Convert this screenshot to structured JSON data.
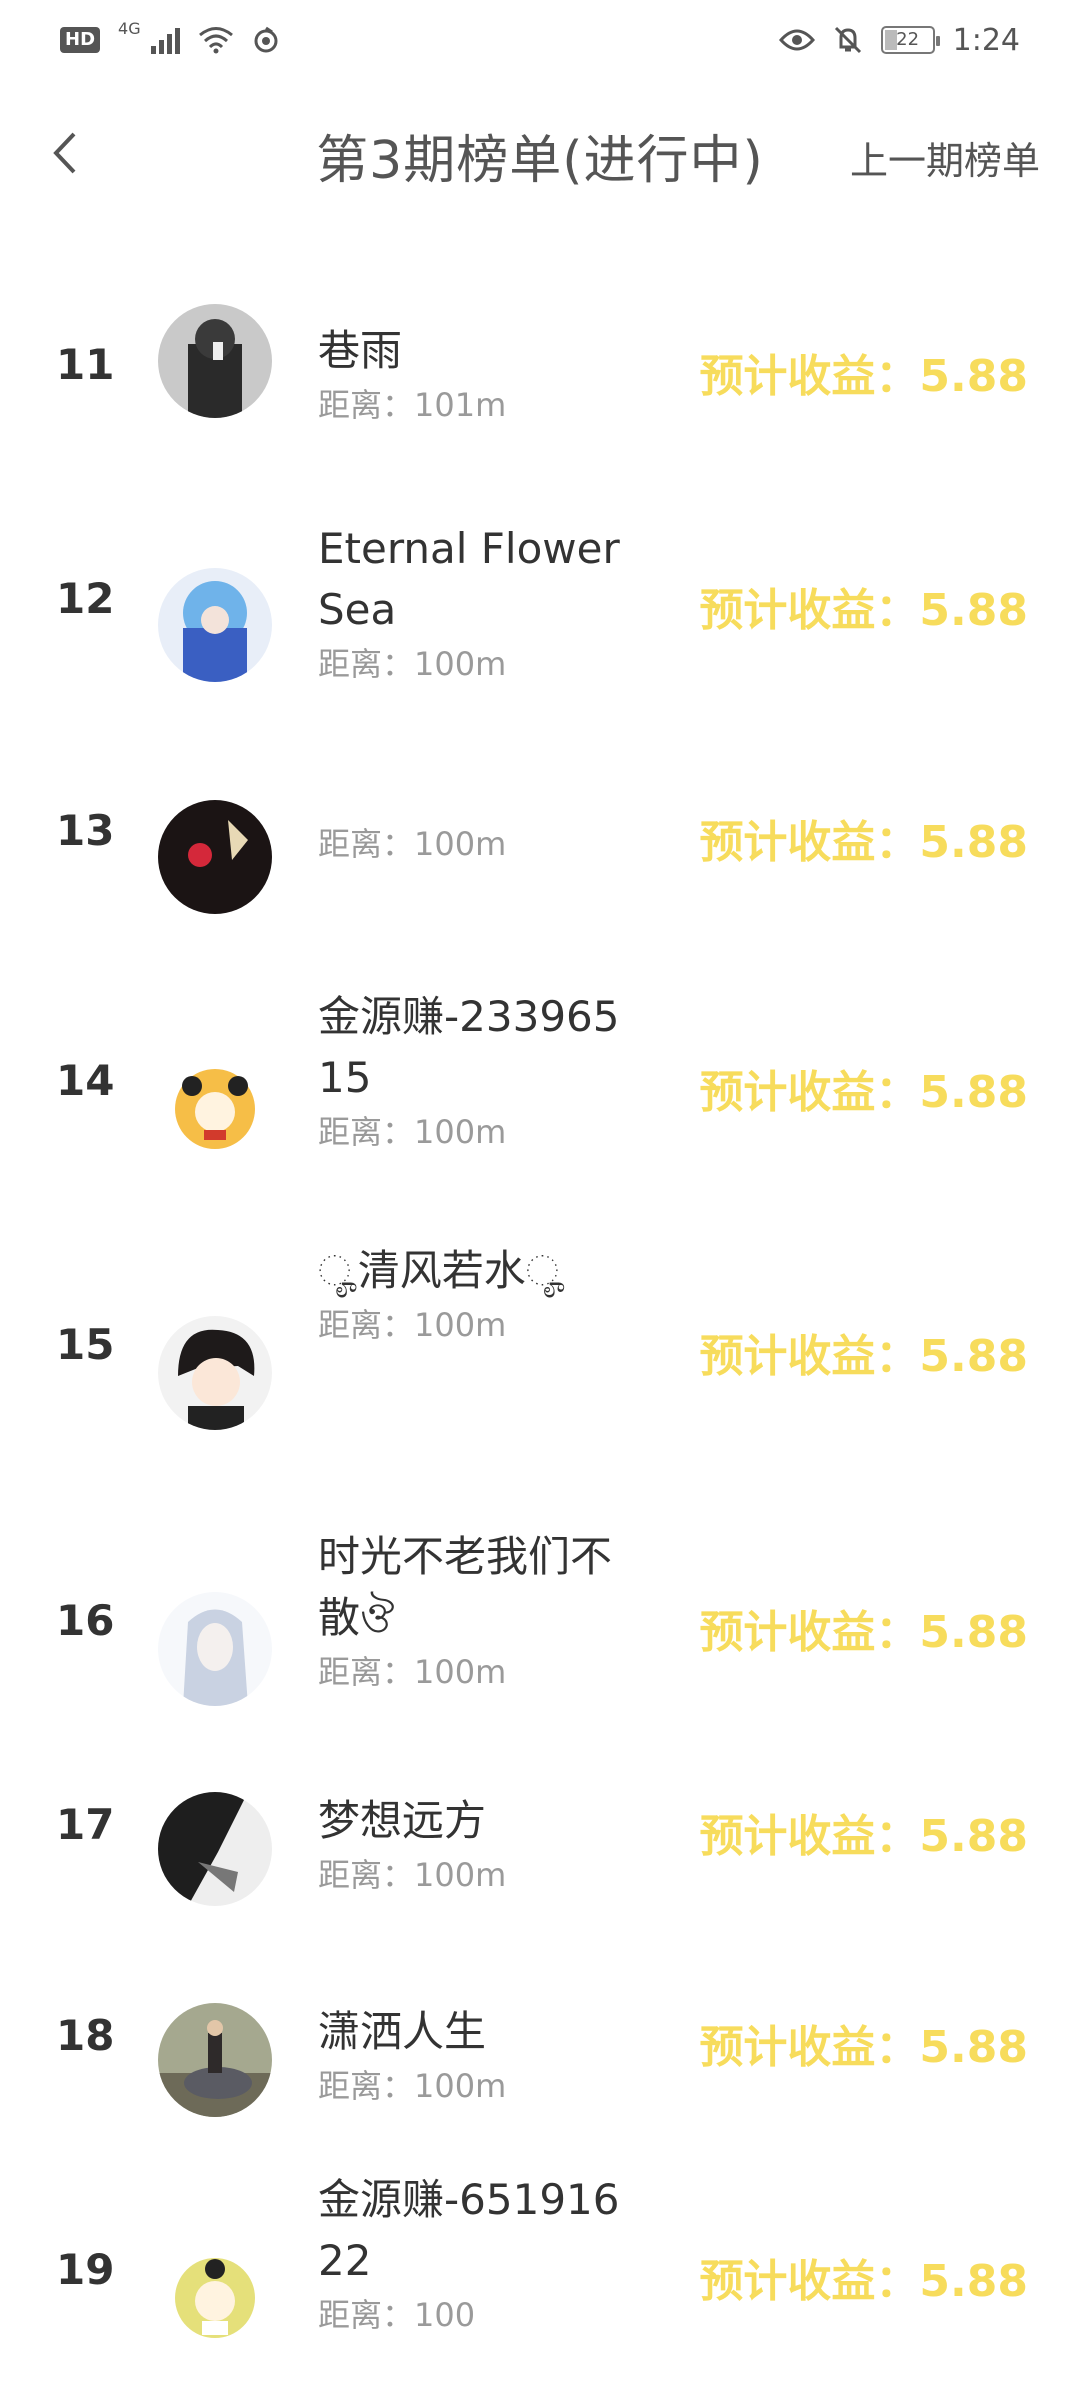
{
  "status_bar": {
    "hd": "HD",
    "network": "4G",
    "time": "1:24",
    "battery": "22"
  },
  "header": {
    "title": "第3期榜单(进行中)",
    "prev_link": "上一期榜单"
  },
  "rows": [
    {
      "rank": "11",
      "name": "巷雨",
      "distance": "距离：101m",
      "earning": "预计收益：5.88"
    },
    {
      "rank": "12",
      "name": "Eternal Flower Sea",
      "distance": "距离：100m",
      "earning": "预计收益：5.88"
    },
    {
      "rank": "13",
      "name": "",
      "distance": "距离：100m",
      "earning": "预计收益：5.88"
    },
    {
      "rank": "14",
      "name": "金源赚-23396515",
      "distance": "距离：100m",
      "earning": "预计收益：5.88"
    },
    {
      "rank": "15",
      "name": "ೄ清风若水ೄ",
      "distance": "距离：100m",
      "earning": "预计收益：5.88"
    },
    {
      "rank": "16",
      "name": "时光不老我们不散ঔ",
      "distance": "距离：100m",
      "earning": "预计收益：5.88"
    },
    {
      "rank": "17",
      "name": "梦想远方",
      "distance": "距离：100m",
      "earning": "预计收益：5.88"
    },
    {
      "rank": "18",
      "name": "潇洒人生",
      "distance": "距离：100m",
      "earning": "预计收益：5.88"
    },
    {
      "rank": "19",
      "name": "金源赚-65191622",
      "distance": "距离：100",
      "earning": "预计收益：5.88"
    }
  ],
  "colors": {
    "earning": "#f7dc5c",
    "distance": "#9a9a9a",
    "text": "#333333"
  }
}
